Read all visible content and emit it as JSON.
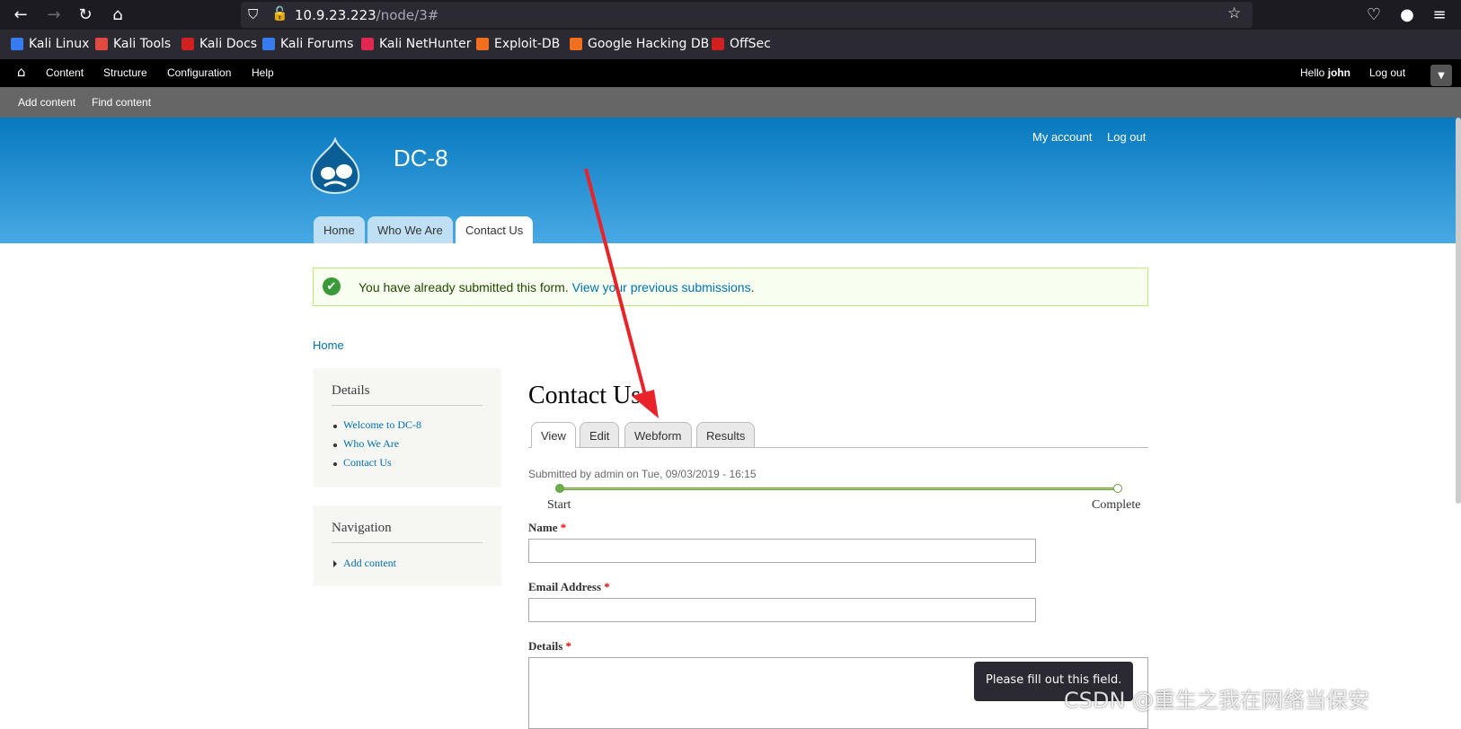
{
  "browser": {
    "url_host": "10.9.23.223",
    "url_path": "/node/3#",
    "bookmarks": [
      "Kali Linux",
      "Kali Tools",
      "Kali Docs",
      "Kali Forums",
      "Kali NetHunter",
      "Exploit-DB",
      "Google Hacking DB",
      "OffSec"
    ]
  },
  "admin": {
    "menu": [
      "Content",
      "Structure",
      "Configuration",
      "Help"
    ],
    "hello": "Hello ",
    "user": "john",
    "logout": "Log out",
    "shortcuts": [
      "Add content",
      "Find content"
    ]
  },
  "header": {
    "site_name": "DC-8",
    "my_account": "My account",
    "log_out": "Log out",
    "tabs": [
      "Home",
      "Who We Are",
      "Contact Us"
    ]
  },
  "status": {
    "text": "You have already submitted this form. ",
    "link": "View your previous submissions",
    "end": "."
  },
  "breadcrumb": "Home",
  "sidebar": {
    "details_title": "Details",
    "details_items": [
      "Welcome to DC-8",
      "Who We Are",
      "Contact Us"
    ],
    "nav_title": "Navigation",
    "nav_items": [
      "Add content"
    ]
  },
  "content": {
    "title": "Contact Us",
    "tabs": [
      "View",
      "Edit",
      "Webform",
      "Results"
    ],
    "submitted": "Submitted by admin on Tue, 09/03/2019 - 16:15",
    "progress_start": "Start",
    "progress_complete": "Complete",
    "fields": [
      "Name",
      "Email Address",
      "Details"
    ],
    "required_mark": "*",
    "tooltip": "Please fill out this field."
  },
  "watermark": "CSDN @重生之我在网络当保安",
  "colors": {
    "header_top": "#0779bf",
    "header_bottom": "#48a9e4",
    "link": "#0071b3",
    "arrow": "#e8232a"
  }
}
